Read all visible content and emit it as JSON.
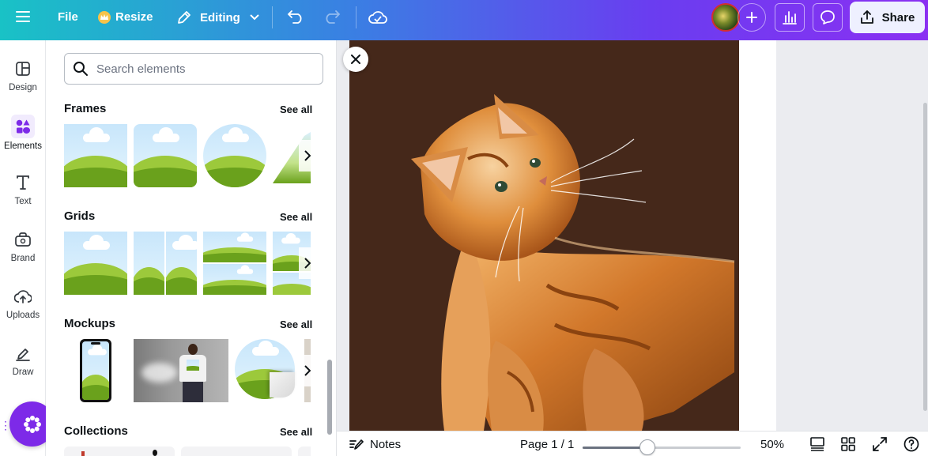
{
  "topbar": {
    "file_label": "File",
    "resize_label": "Resize",
    "editing_label": "Editing",
    "share_label": "Share"
  },
  "rail": {
    "items": [
      {
        "label": "Design",
        "icon": "layout-icon"
      },
      {
        "label": "Elements",
        "icon": "elements-icon"
      },
      {
        "label": "Text",
        "icon": "text-icon"
      },
      {
        "label": "Brand",
        "icon": "brand-icon"
      },
      {
        "label": "Uploads",
        "icon": "cloud-upload-icon"
      },
      {
        "label": "Draw",
        "icon": "pen-icon"
      }
    ]
  },
  "panel": {
    "search_placeholder": "Search elements",
    "see_all": "See all",
    "sections": [
      {
        "title": "Frames"
      },
      {
        "title": "Grids"
      },
      {
        "title": "Mockups"
      },
      {
        "title": "Collections"
      }
    ]
  },
  "bottombar": {
    "notes_label": "Notes",
    "page_label": "Page 1 / 1",
    "zoom_label": "50%",
    "zoom_value": 0.5
  },
  "colors": {
    "accent": "#7d2ae8",
    "photo_bg": "#45281a"
  }
}
